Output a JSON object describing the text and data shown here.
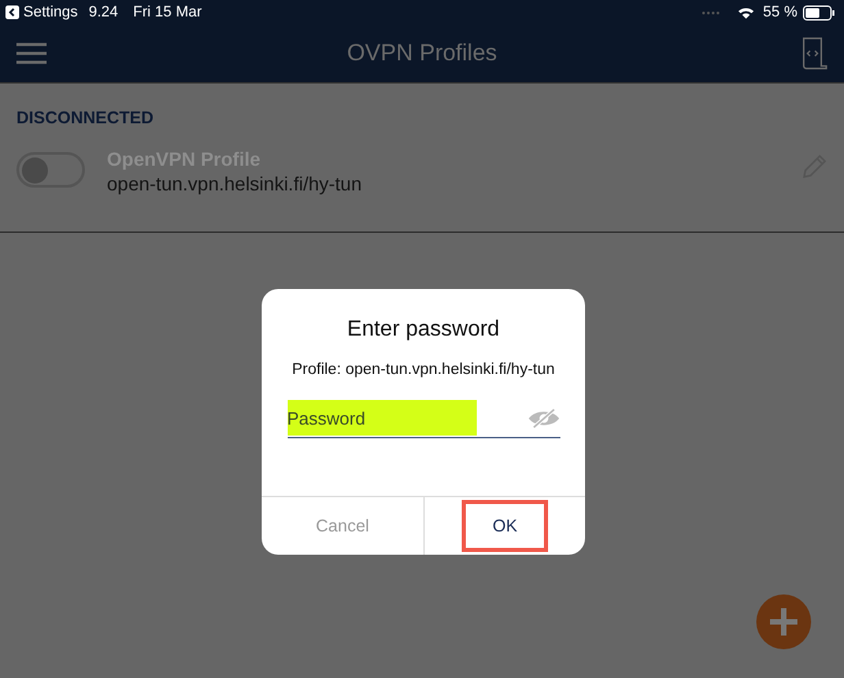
{
  "status_bar": {
    "back_label": "Settings",
    "time": "9.24",
    "date": "Fri 15 Mar",
    "battery": "55 %"
  },
  "nav_bar": {
    "title": "OVPN Profiles"
  },
  "section": {
    "heading": "DISCONNECTED"
  },
  "profiles": [
    {
      "name": "OpenVPN Profile",
      "host": "open-tun.vpn.helsinki.fi/hy-tun",
      "on": false
    }
  ],
  "dialog": {
    "title": "Enter password",
    "message": "Profile: open-tun.vpn.helsinki.fi/hy-tun",
    "field": {
      "placeholder": "Password",
      "highlighted": true
    },
    "buttons": [
      {
        "label": "Cancel",
        "kind": "cancel",
        "highlighted": false
      },
      {
        "label": "OK",
        "kind": "confirm",
        "highlighted": true
      }
    ]
  }
}
